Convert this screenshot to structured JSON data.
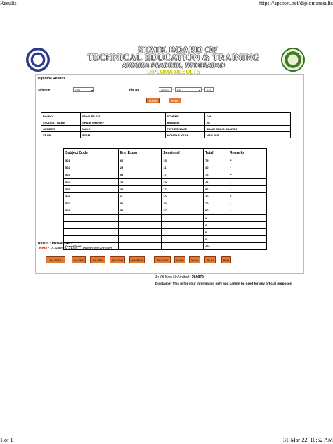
{
  "browser": {
    "tab_title": "Results",
    "url": "https://apsbtet.net/diplomaresults",
    "page_count": "1 of 1",
    "datetime": "31-Mar-22, 10:52 AM"
  },
  "header": {
    "line1": "STATE BOARD OF",
    "line2": "TECHNICAL EDUCATION & TRAINING",
    "line3": "ANDHRA PRADESH, HYDERABAD",
    "line4": "DIPLOMA RESULTS"
  },
  "form": {
    "section_title": "Diploma Results",
    "scheme_label": "Scheme",
    "scheme_value": "C05",
    "pin_label": "Pin No",
    "pin_part1": "08041",
    "pin_part2": "EE",
    "pin_part3": "245",
    "submit_label": "Submit",
    "reset_label": "Reset"
  },
  "student": {
    "rows": [
      {
        "k1": "PIN NO",
        "v1": "08041-EE-245",
        "k2": "SCHEME",
        "v2": "C05"
      },
      {
        "k1": "STUDENT NAME",
        "v1": "SHAIK SHARIEF",
        "k2": "BRANCH",
        "v2": "EE"
      },
      {
        "k1": "GENDER",
        "v1": "MALE",
        "k2": "FATHER NAME",
        "v2": "SHAIK GALIB SHARIEF"
      },
      {
        "k1": "YEAR",
        "v1": "5SEM",
        "k2": "MONTH & YEAR",
        "v2": "MAR 2021"
      }
    ]
  },
  "marks": {
    "headers": [
      "Subject Code",
      "End Exam",
      "Sessional",
      "Total",
      "Remarks"
    ],
    "rows": [
      [
        "501",
        "60",
        "15",
        "75",
        "P"
      ],
      [
        "502",
        "29",
        "11",
        "40",
        "*"
      ],
      [
        "503",
        "59",
        "17",
        "76",
        "P"
      ],
      [
        "504",
        "28",
        "15",
        "43",
        "*"
      ],
      [
        "505",
        "35",
        "17",
        "52",
        "*"
      ],
      [
        "506",
        "0",
        "20",
        "20",
        "F"
      ],
      [
        "507",
        "50",
        "20",
        "70",
        "*"
      ],
      [
        "508",
        "53",
        "37",
        "90",
        "*"
      ],
      [
        "",
        "",
        "",
        "0",
        ""
      ],
      [
        "",
        "",
        "",
        "0",
        ""
      ],
      [
        "",
        "",
        "",
        "0",
        ""
      ],
      [
        "",
        "",
        "",
        "0",
        ""
      ]
    ],
    "grand_total_label": "Grand Total :",
    "grand_total_value": "466"
  },
  "result": {
    "text": "Result : PROMOTED",
    "note_label": "Note :",
    "note_text": "P - Pass;   F - Fail;   * - Previously Passed."
  },
  "semester_buttons": [
    "1st YEAR",
    "3rd SEM",
    "4th SEM",
    "5th SEM",
    "6th SEM",
    "7th SEM",
    "2nd Yr",
    "3rd Yr",
    "4th Yr",
    "Print"
  ],
  "footer": {
    "visited_label": "As Of Now No Visited :",
    "visited_count": "269979",
    "disclaimer": "Disclaimer This is for your information only and cannot be used for any official purposes."
  }
}
